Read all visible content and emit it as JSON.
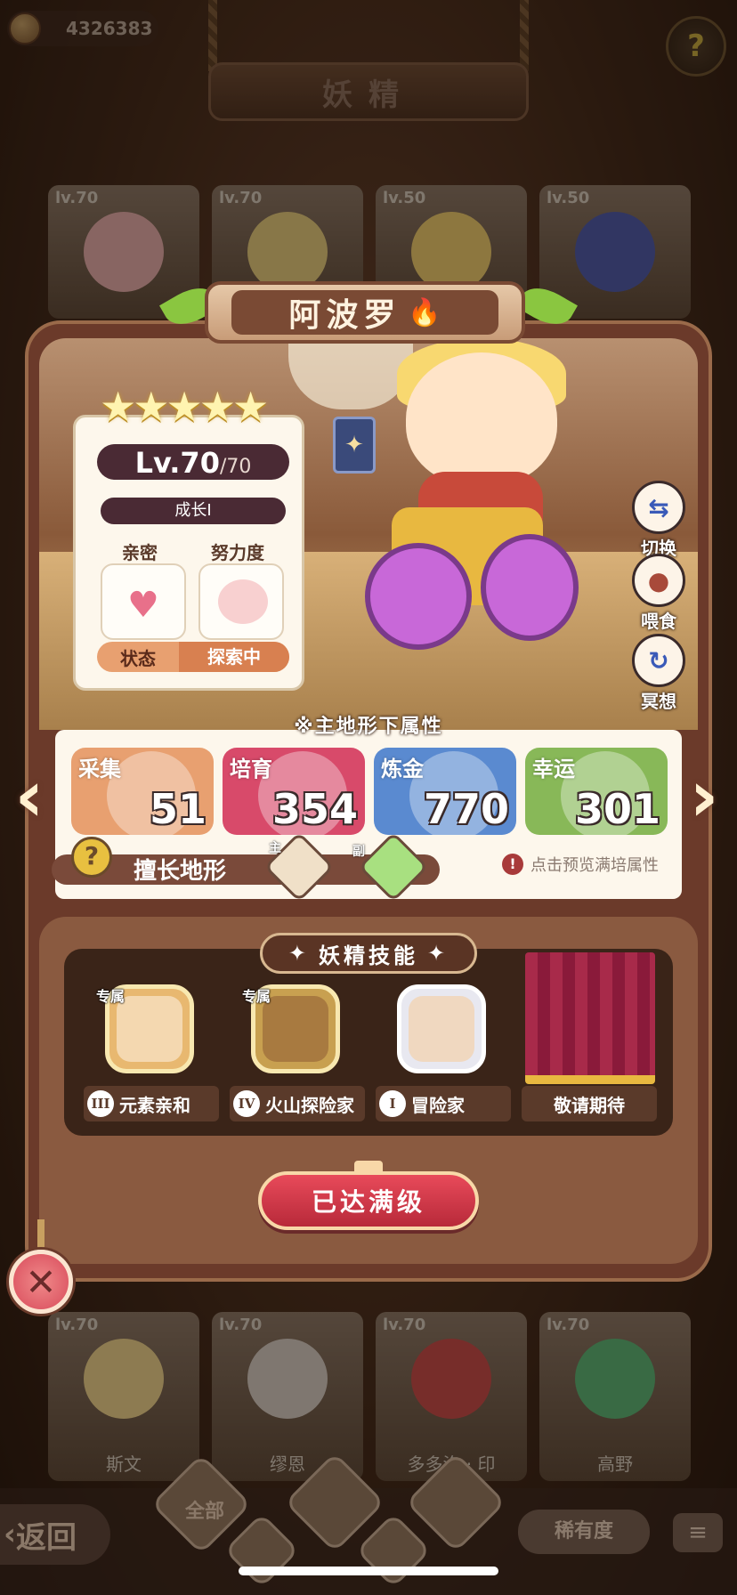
{
  "top": {
    "coins": "4326383",
    "title": "妖精",
    "help_icon": "?"
  },
  "background_cards_top": [
    {
      "level": "lv.70"
    },
    {
      "level": "lv.70"
    },
    {
      "level": "lv.50"
    },
    {
      "level": "lv.50"
    }
  ],
  "background_cards_bottom": [
    {
      "level": "lv.70",
      "name": "斯文"
    },
    {
      "level": "lv.70",
      "name": "缪恩"
    },
    {
      "level": "lv.70",
      "name": "多多洛 · 印"
    },
    {
      "level": "lv.70",
      "name": "高野"
    }
  ],
  "fairy": {
    "name": "阿波罗",
    "stars": "★★★★★",
    "level": "Lv.70",
    "level_max": "/70",
    "growth": "成长Ⅰ",
    "intimacy_label": "亲密",
    "effort_label": "努力度",
    "status_label": "状态",
    "status_value": "探索中"
  },
  "side_actions": {
    "switch": "切换",
    "feed": "喂食",
    "meditate": "冥想"
  },
  "attributes": {
    "heading": "※主地形下属性",
    "items": [
      {
        "name": "采集",
        "value": "51",
        "color": "#e8a070"
      },
      {
        "name": "培育",
        "value": "354",
        "color": "#d84a6a"
      },
      {
        "name": "炼金",
        "value": "770",
        "color": "#5a8ad0"
      },
      {
        "name": "幸运",
        "value": "301",
        "color": "#88b858"
      }
    ],
    "terrain_label": "擅长地形",
    "terrain_main": "主",
    "terrain_sub": "副",
    "preview_text": "点击预览满培属性"
  },
  "skills": {
    "heading": "妖精技能",
    "exclusive_tag": "专属",
    "items": [
      {
        "rank": "III",
        "name": "元素亲和"
      },
      {
        "rank": "IV",
        "name": "火山探险家"
      },
      {
        "rank": "I",
        "name": "冒险家"
      },
      {
        "rank": "",
        "name": "敬请期待"
      }
    ]
  },
  "max_level_button": "已达满级",
  "bottom": {
    "back": "返回",
    "all": "全部",
    "rarity": "稀有度"
  },
  "colors": {
    "accent_red": "#d84a5a",
    "panel_brown": "#6b3a2a",
    "cream": "#fdf7ec"
  }
}
